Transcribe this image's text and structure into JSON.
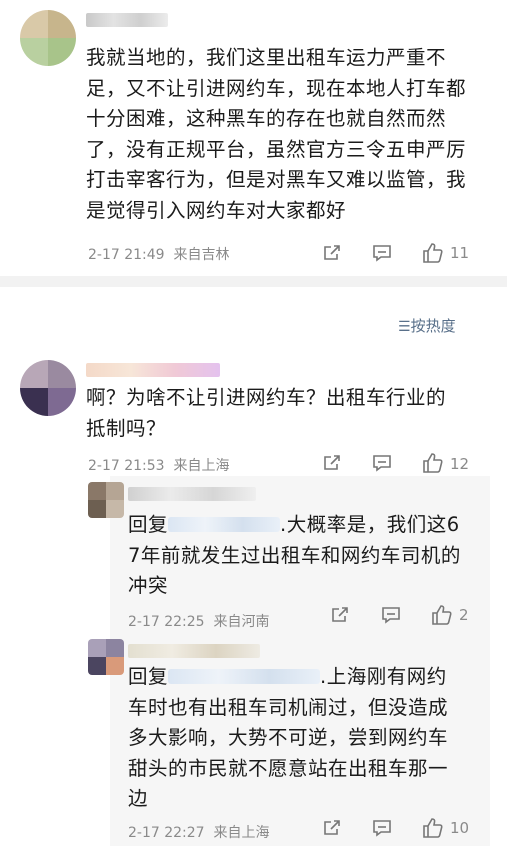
{
  "comments": [
    {
      "text": "我就当地的，我们这里出租车运力严重不足，又不让引进网约车，现在本地人打车都十分困难，这种黑车的存在也就自然而然了，没有正规平台，虽然官方三令五申严厉打击宰客行为，但是对黑车又难以监管，我是觉得引入网约车对大家都好",
      "lines": [
        "我就当地的，我们这里出租车运力严重不",
        "足，又不让引进网约车，现在本地人打车都",
        "十分困难，这种黑车的存在也就自然而然",
        "了，没有正规平台，虽然官方三令五申严厉",
        "打击宰客行为，但是对黑车又难以监管，我",
        "是觉得引入网约车对大家都好"
      ],
      "time": "2-17 21:49",
      "source": "来自吉林",
      "likes": "11"
    },
    {
      "lines": [
        "啊？为啥不让引进网约车？出租车行业的",
        "抵制吗？"
      ],
      "time": "2-17 21:53",
      "source": "来自上海",
      "likes": "12"
    }
  ],
  "sort_label": "按热度",
  "sort_icon": "sort-icon",
  "replies": [
    {
      "prefix": "回复",
      "line1_tail": ".大概率是，我们这6",
      "lines": [
        "7年前就发生过出租车和网约车司机的",
        "冲突"
      ],
      "time": "2-17 22:25",
      "source": "来自河南",
      "likes": "2"
    },
    {
      "prefix": "回复",
      "line1_tail": ".上海刚有网约",
      "lines": [
        "车时也有出租车司机闹过，但没造成",
        "多大影响，大势不可逆，尝到网约车",
        "甜头的市民就不愿意站在出租车那一",
        "边"
      ],
      "time": "2-17 22:27",
      "source": "来自上海",
      "likes": "10"
    }
  ],
  "colors": {
    "link": "#59708a",
    "meta": "#8a8a8a",
    "text": "#1b1b1b"
  }
}
